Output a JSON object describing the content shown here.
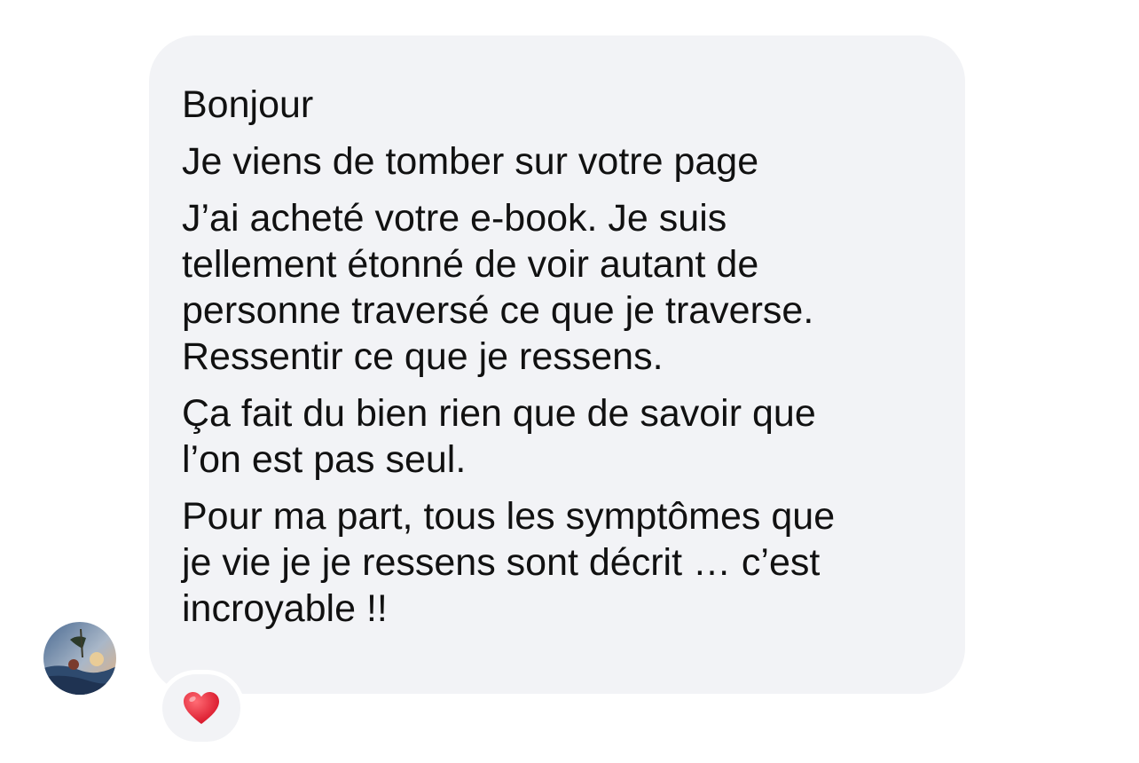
{
  "message": {
    "paragraphs": [
      {
        "lines": [
          "Bonjour"
        ]
      },
      {
        "lines": [
          "Je viens de tomber sur votre page"
        ]
      },
      {
        "lines": [
          "J’ai acheté votre e-book. Je suis",
          "tellement étonné de voir autant de",
          "personne traversé ce que je traverse.",
          "Ressentir ce que je ressens."
        ]
      },
      {
        "lines": [
          "Ça fait du bien rien que de savoir que",
          "l’on est pas seul."
        ]
      },
      {
        "lines": [
          "Pour ma part, tous les symptômes que",
          "je vie je je ressens sont décrit … c’est",
          "incroyable !!"
        ]
      }
    ]
  },
  "reaction": {
    "icon": "red-heart-icon",
    "color": "#e0202f"
  },
  "avatar": {
    "icon": "avatar-photo-icon"
  },
  "colors": {
    "bubble": "#f2f3f6",
    "text": "#111111",
    "background": "#ffffff"
  }
}
